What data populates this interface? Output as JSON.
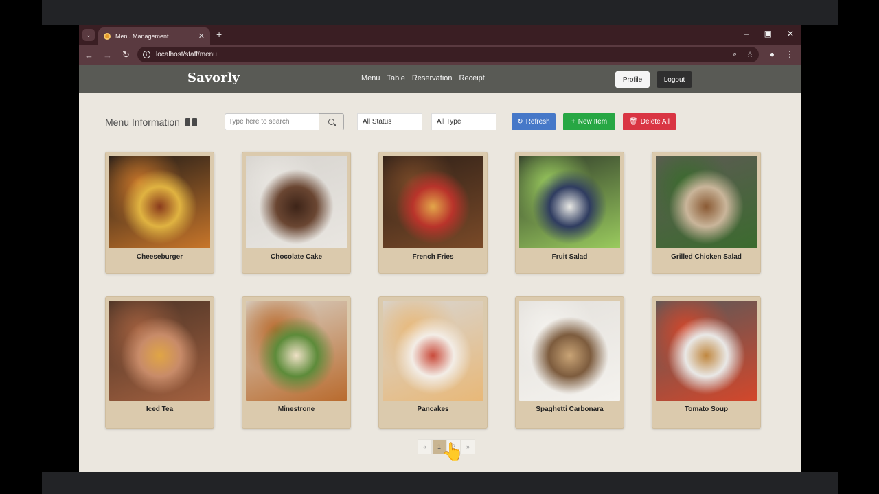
{
  "browser": {
    "tab_title": "Menu Management",
    "url": "localhost/staff/menu"
  },
  "header": {
    "brand": "Savorly",
    "nav": [
      "Menu",
      "Table",
      "Reservation",
      "Receipt"
    ],
    "profile_label": "Profile",
    "logout_label": "Logout"
  },
  "toolbar": {
    "title": "Menu Information",
    "search_placeholder": "Type here to search",
    "status_filter": "All Status",
    "type_filter": "All Type",
    "refresh_label": "Refresh",
    "new_item_label": "New Item",
    "delete_all_label": "Delete All"
  },
  "menu_items": [
    {
      "name": "Cheeseburger",
      "image": "cheeseburger",
      "colors": [
        "#1f1a18",
        "#c8762a",
        "#8a3b1c",
        "#e0b341"
      ]
    },
    {
      "name": "Chocolate Cake",
      "image": "chocolate-cake",
      "colors": [
        "#d7d4cf",
        "#e9e6e1",
        "#3d2418",
        "#6a4632"
      ]
    },
    {
      "name": "French Fries",
      "image": "french-fries",
      "colors": [
        "#2e2018",
        "#7a4a28",
        "#e3a64a",
        "#b9342b"
      ]
    },
    {
      "name": "Fruit Salad",
      "image": "fruit-salad",
      "colors": [
        "#2f3a2a",
        "#9acb5e",
        "#e8e8e4",
        "#2f3c60"
      ]
    },
    {
      "name": "Grilled Chicken Salad",
      "image": "grilled-chicken-salad",
      "colors": [
        "#5e5a55",
        "#3b6b2e",
        "#8a5a34",
        "#c9b59a"
      ]
    },
    {
      "name": "Iced Tea",
      "image": "iced-tea",
      "colors": [
        "#4a3326",
        "#a2603f",
        "#e0a545",
        "#c88b69"
      ]
    },
    {
      "name": "Minestrone",
      "image": "minestrone",
      "colors": [
        "#d9d2c7",
        "#b96b2e",
        "#efe1c6",
        "#5d8b3a"
      ]
    },
    {
      "name": "Pancakes",
      "image": "pancakes",
      "colors": [
        "#d8d6d3",
        "#e8b878",
        "#c94a3a",
        "#f3ede6"
      ]
    },
    {
      "name": "Spaghetti Carbonara",
      "image": "spaghetti-carbonara",
      "colors": [
        "#e4e1dc",
        "#f4f2ee",
        "#c9a476",
        "#7d5c3e"
      ]
    },
    {
      "name": "Tomato Soup",
      "image": "tomato-soup",
      "colors": [
        "#58595a",
        "#d3472b",
        "#c0873f",
        "#e9e8e6"
      ]
    }
  ],
  "pagination": {
    "prev": "«",
    "pages": [
      "1",
      "2"
    ],
    "next": "»",
    "current": "1"
  }
}
